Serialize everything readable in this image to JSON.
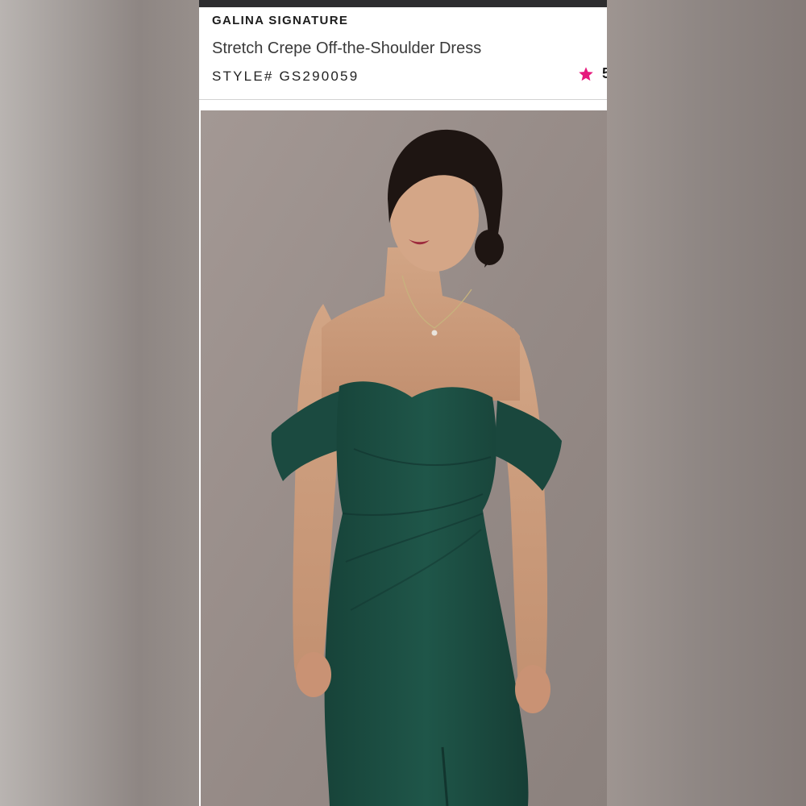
{
  "product": {
    "brand": "GALINA SIGNATURE",
    "title": "Stretch Crepe Off-the-Shoulder Dress",
    "style_label": "STYLE#",
    "style_number": "GS290059",
    "rating_icon": "star-icon",
    "rating_value": "5",
    "accent_color": "#e6197d"
  },
  "photo": {
    "subject": "model-in-emerald-off-shoulder-dress",
    "dress_color": "#1e5247",
    "backdrop_color": "#9a8f8b"
  }
}
